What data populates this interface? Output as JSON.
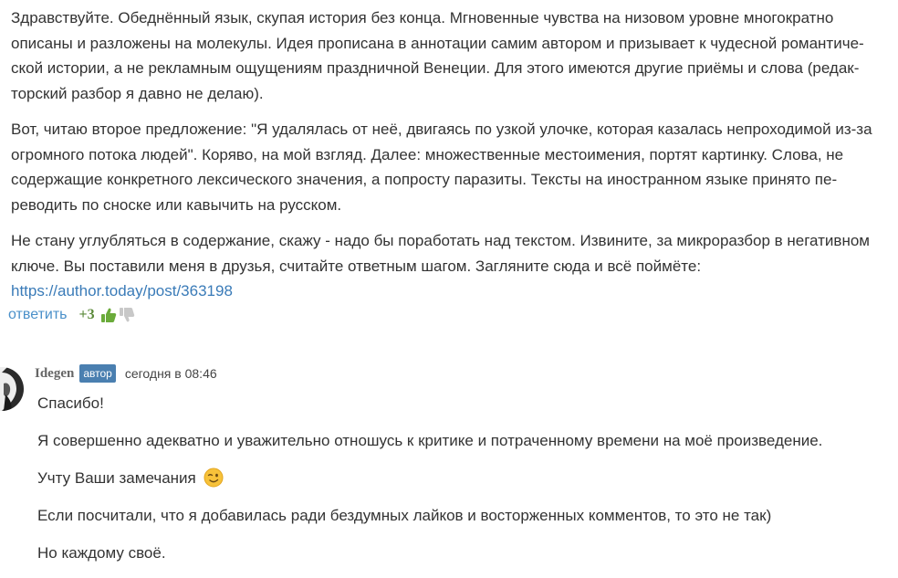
{
  "comment1": {
    "paragraphs": [
      "Здравствуйте. Обеднённый язык, скупая история без конца. Мгновенные чувства на низовом уровне многократно описаны и разложены на молекулы. Идея прописана в аннотации самим автором и призывает к чудесной романтиче­ской истории, а не рекламным ощущениям праздничной Венеции. Для этого имеются другие приёмы и слова (редак­торский разбор я давно не делаю).",
      "Вот, читаю второе предложение: \"Я удалялась от неё, двигаясь по узкой улочке, которая казалась непроходимой из-за огромного потока людей\". Коряво, на мой взгляд. Далее: множественные местоимения, портят картинку. Слова, не содержащие конкретного лексического значения, а попросту паразиты. Тексты на иностранном языке принято пе­реводить по сноске или кавычить на русском.",
      "Не стану углубляться в содержание, скажу - надо бы поработать над текстом. Извините, за микроразбор в негатив­ном ключе. Вы поставили меня в друзья, считайте ответным шагом. Загляните сюда и всё поймёте:"
    ],
    "link": "https://author.today/post/363198",
    "reply_label": "ответить",
    "rating": "+3",
    "colors": {
      "link": "#3a7bb8",
      "reply": "#4a90c9",
      "rating": "#5b8a3a",
      "thumb_up": "#6aab3a",
      "thumb_down": "#c8c8c8"
    }
  },
  "comment2": {
    "author": "Idegen",
    "badge": "автор",
    "date": "сегодня в 08:46",
    "paragraphs": [
      "Спасибо!",
      "Я совершенно адекватно и уважительно отношусь к критике и потраченному времени на моё произведение.",
      "Учту Ваши замечания",
      "Если посчитали, что я добавилась ради бездумных лайков и восторженных комментов, то это не так)",
      "Но каждому своё."
    ],
    "emoji": "winking-face",
    "colors": {
      "badge": "#4a7fb0",
      "author": "#666666"
    }
  }
}
